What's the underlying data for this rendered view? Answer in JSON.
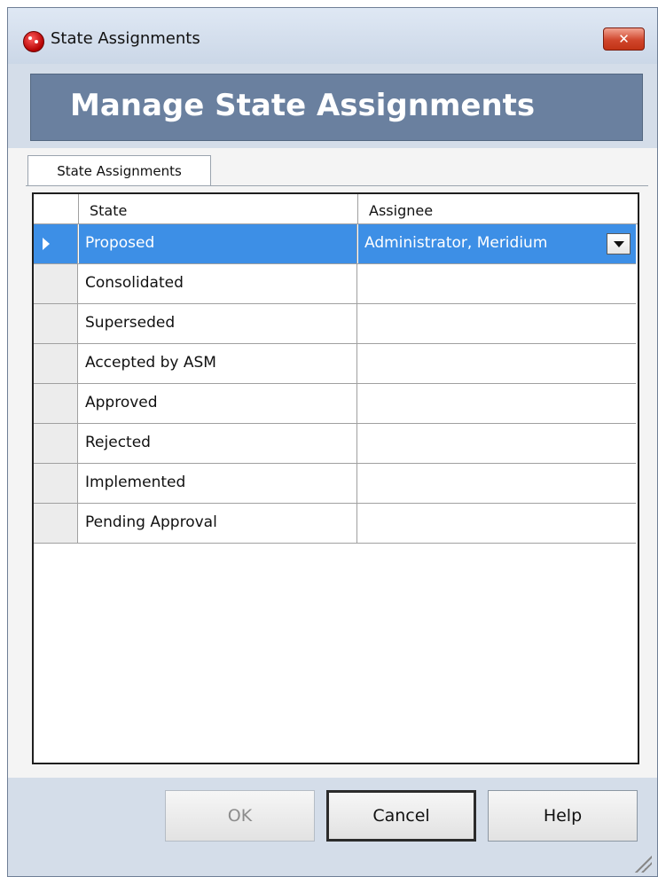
{
  "window": {
    "title": "State Assignments",
    "close_label": "✕"
  },
  "header": {
    "title": "Manage State Assignments"
  },
  "tabs": [
    {
      "label": "State Assignments",
      "active": true
    }
  ],
  "grid": {
    "columns": [
      "State",
      "Assignee"
    ],
    "rows": [
      {
        "state": "Proposed",
        "assignee": "Administrator, Meridium",
        "selected": true
      },
      {
        "state": "Consolidated",
        "assignee": ""
      },
      {
        "state": "Superseded",
        "assignee": ""
      },
      {
        "state": "Accepted by ASM",
        "assignee": ""
      },
      {
        "state": "Approved",
        "assignee": ""
      },
      {
        "state": "Rejected",
        "assignee": ""
      },
      {
        "state": "Implemented",
        "assignee": ""
      },
      {
        "state": "Pending Approval",
        "assignee": ""
      }
    ]
  },
  "buttons": {
    "ok": "OK",
    "cancel": "Cancel",
    "help": "Help"
  },
  "colors": {
    "selection": "#3d8fe6",
    "banner": "#6a809f",
    "close": "#c23316"
  },
  "icons": {
    "app": "meridium-app-icon",
    "close": "close-icon",
    "row_indicator": "row-pointer-icon",
    "dropdown": "chevron-down-icon",
    "resize": "resize-grip-icon"
  }
}
